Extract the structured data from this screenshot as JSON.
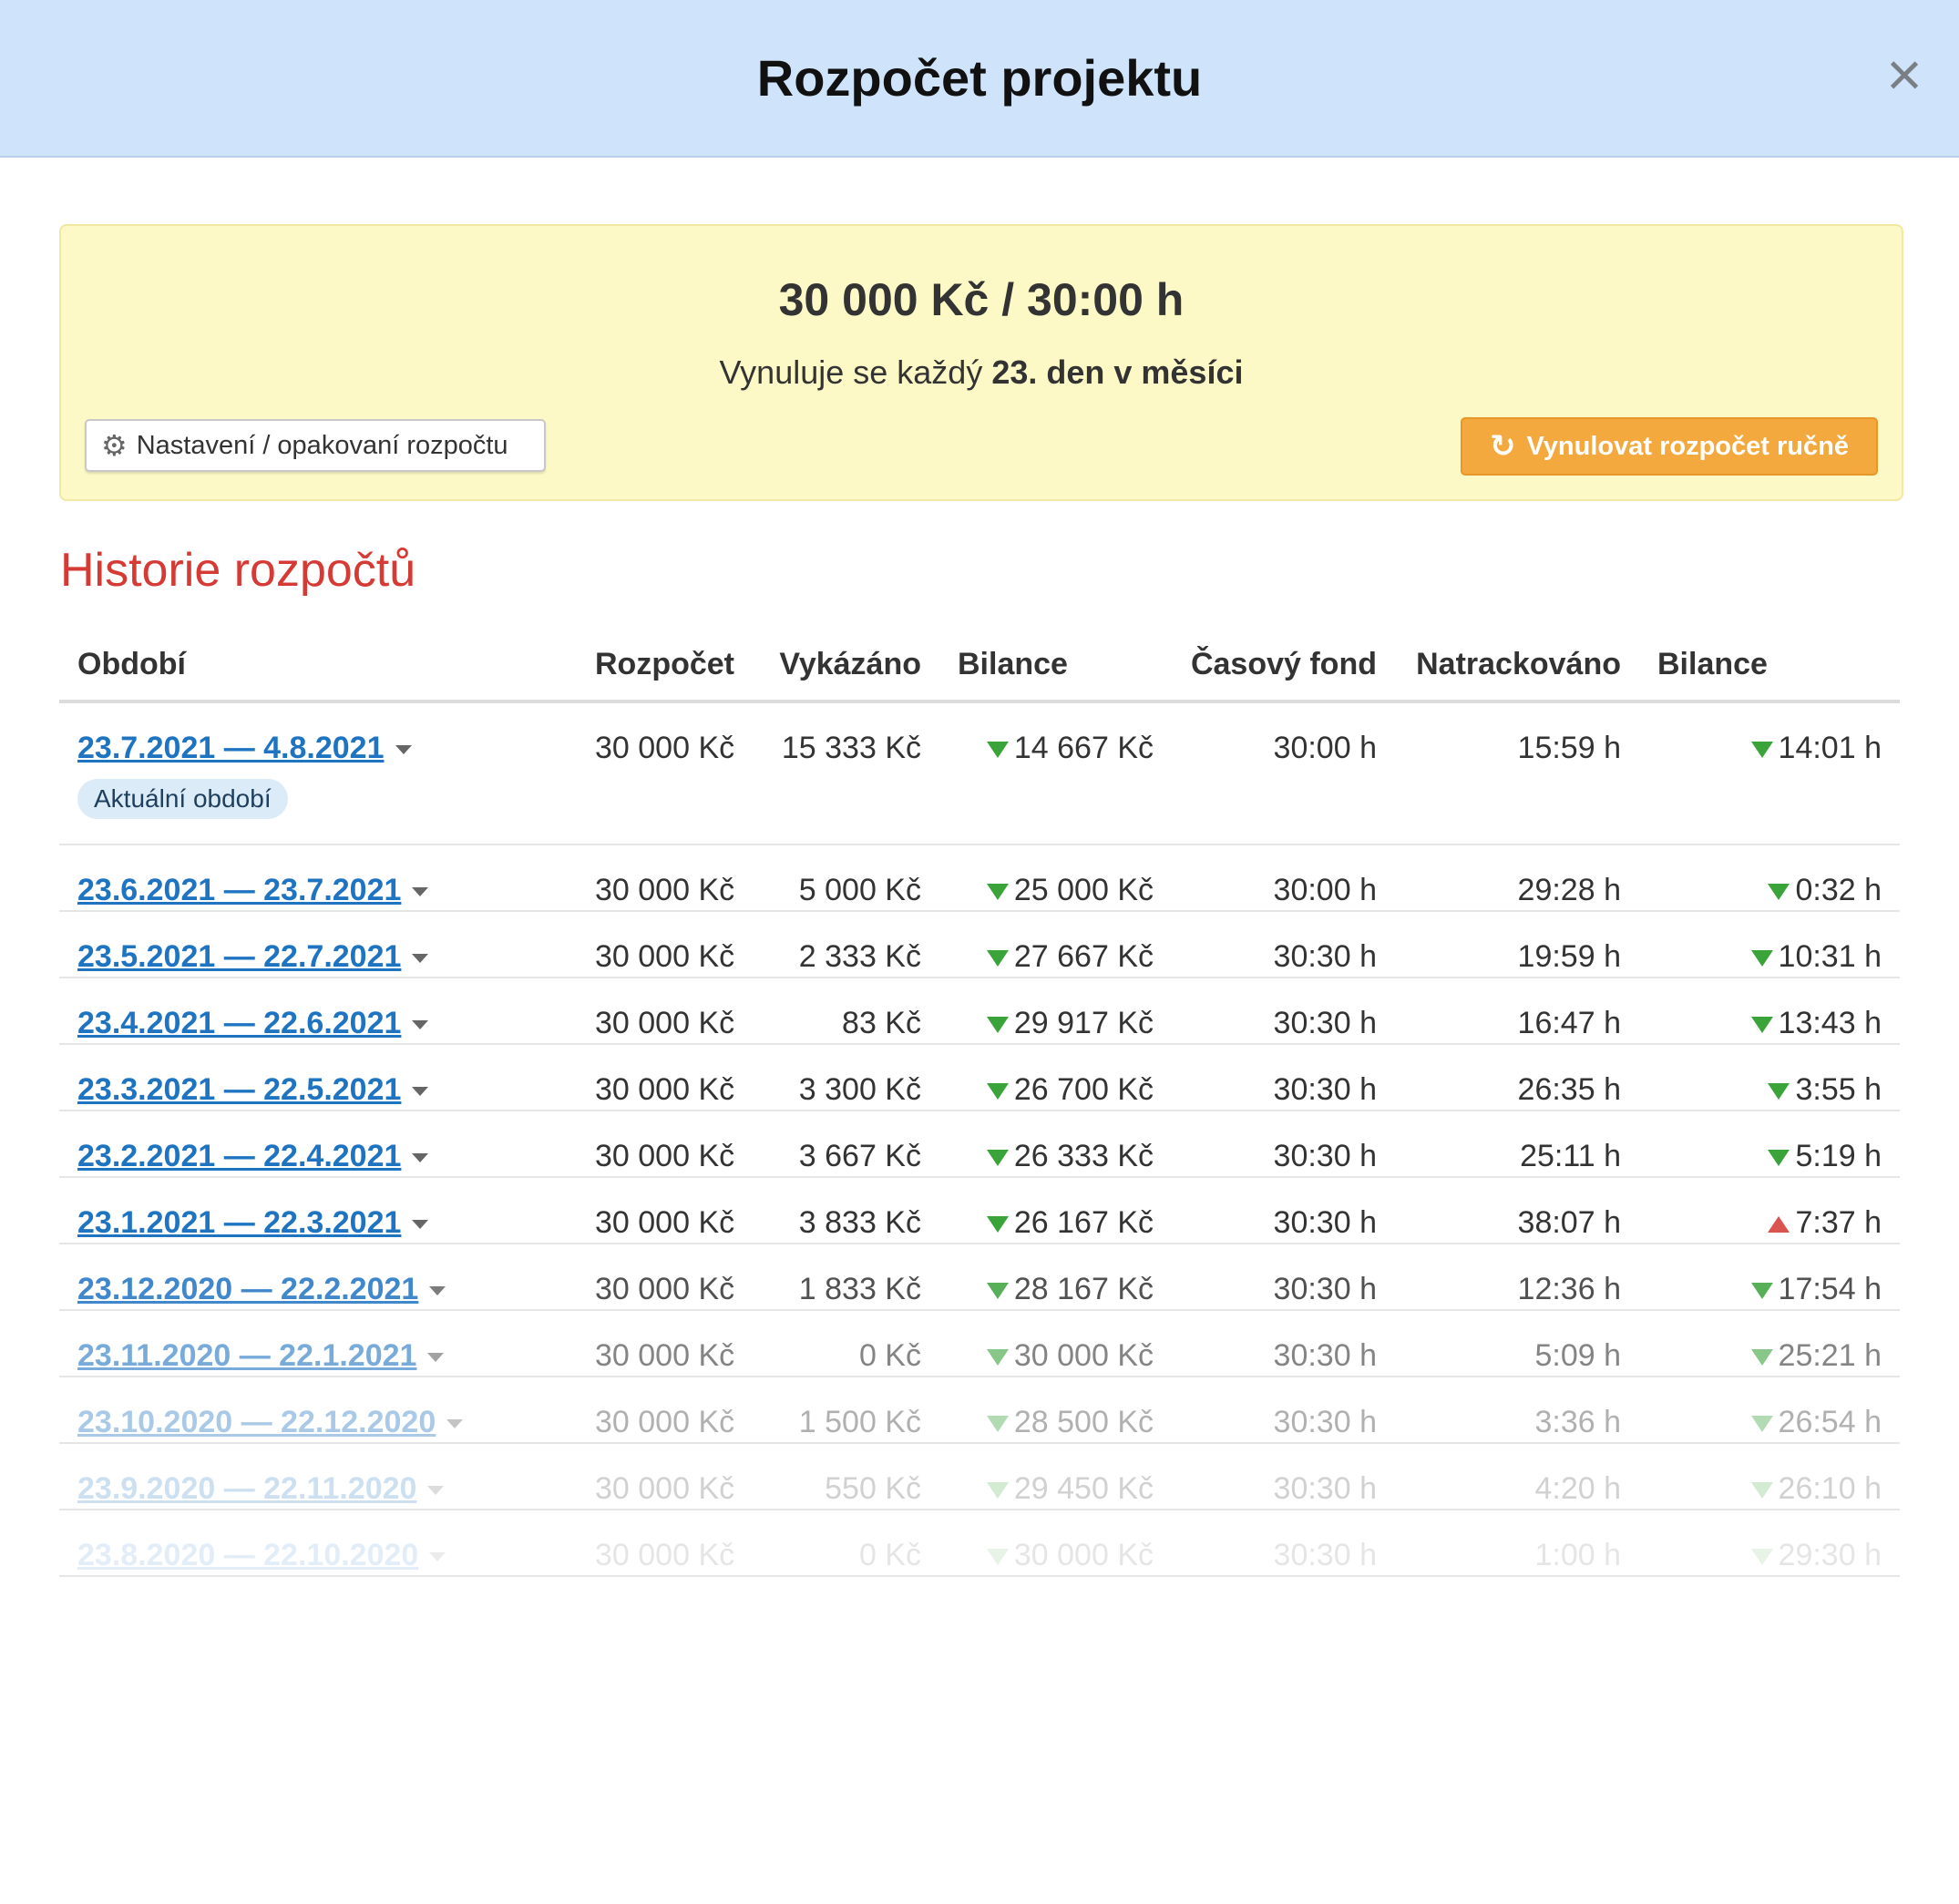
{
  "modal": {
    "title": "Rozpočet projektu",
    "close_label": "×"
  },
  "budget": {
    "amount": "30 000 Kč / 30:00 h",
    "reset_prefix": "Vynuluje se každý ",
    "reset_day": "23. den v měsíci",
    "settings_button": "Nastavení / opakovaní rozpočtu",
    "reset_button": "Vynulovat rozpočet ručně",
    "reset_button_color": "#f4a93f"
  },
  "history": {
    "title": "Historie rozpočtů",
    "columns": [
      "Období",
      "Rozpočet",
      "Vykázáno",
      "Bilance",
      "Časový fond",
      "Natrackováno",
      "Bilance"
    ],
    "current_badge": "Aktuální období",
    "rows": [
      {
        "period": "23.7.2021 — 4.8.2021",
        "budget": "30 000 Kč",
        "reported": "15 333 Kč",
        "balance": "14 667 Kč",
        "balance_dir": "down",
        "fund": "30:00 h",
        "tracked": "15:59 h",
        "time_balance": "14:01 h",
        "time_dir": "down",
        "current": true,
        "fade": 0
      },
      {
        "period": "23.6.2021 — 23.7.2021",
        "budget": "30 000 Kč",
        "reported": "5 000 Kč",
        "balance": "25 000 Kč",
        "balance_dir": "down",
        "fund": "30:00 h",
        "tracked": "29:28 h",
        "time_balance": "0:32 h",
        "time_dir": "down",
        "current": false,
        "fade": 0
      },
      {
        "period": "23.5.2021 — 22.7.2021",
        "budget": "30 000 Kč",
        "reported": "2 333 Kč",
        "balance": "27 667 Kč",
        "balance_dir": "down",
        "fund": "30:30 h",
        "tracked": "19:59 h",
        "time_balance": "10:31 h",
        "time_dir": "down",
        "current": false,
        "fade": 0
      },
      {
        "period": "23.4.2021 — 22.6.2021",
        "budget": "30 000 Kč",
        "reported": "83 Kč",
        "balance": "29 917 Kč",
        "balance_dir": "down",
        "fund": "30:30 h",
        "tracked": "16:47 h",
        "time_balance": "13:43 h",
        "time_dir": "down",
        "current": false,
        "fade": 0
      },
      {
        "period": "23.3.2021 — 22.5.2021",
        "budget": "30 000 Kč",
        "reported": "3 300 Kč",
        "balance": "26 700 Kč",
        "balance_dir": "down",
        "fund": "30:30 h",
        "tracked": "26:35 h",
        "time_balance": "3:55 h",
        "time_dir": "down",
        "current": false,
        "fade": 0
      },
      {
        "period": "23.2.2021 — 22.4.2021",
        "budget": "30 000 Kč",
        "reported": "3 667 Kč",
        "balance": "26 333 Kč",
        "balance_dir": "down",
        "fund": "30:30 h",
        "tracked": "25:11 h",
        "time_balance": "5:19 h",
        "time_dir": "down",
        "current": false,
        "fade": 0
      },
      {
        "period": "23.1.2021 — 22.3.2021",
        "budget": "30 000 Kč",
        "reported": "3 833 Kč",
        "balance": "26 167 Kč",
        "balance_dir": "down",
        "fund": "30:30 h",
        "tracked": "38:07 h",
        "time_balance": "7:37 h",
        "time_dir": "up",
        "current": false,
        "fade": 0
      },
      {
        "period": "23.12.2020 — 22.2.2021",
        "budget": "30 000 Kč",
        "reported": "1 833 Kč",
        "balance": "28 167 Kč",
        "balance_dir": "down",
        "fund": "30:30 h",
        "tracked": "12:36 h",
        "time_balance": "17:54 h",
        "time_dir": "down",
        "current": false,
        "fade": 1
      },
      {
        "period": "23.11.2020 — 22.1.2021",
        "budget": "30 000 Kč",
        "reported": "0 Kč",
        "balance": "30 000 Kč",
        "balance_dir": "down",
        "fund": "30:30 h",
        "tracked": "5:09 h",
        "time_balance": "25:21 h",
        "time_dir": "down",
        "current": false,
        "fade": 2
      },
      {
        "period": "23.10.2020 — 22.12.2020",
        "budget": "30 000 Kč",
        "reported": "1 500 Kč",
        "balance": "28 500 Kč",
        "balance_dir": "down",
        "fund": "30:30 h",
        "tracked": "3:36 h",
        "time_balance": "26:54 h",
        "time_dir": "down",
        "current": false,
        "fade": 3
      },
      {
        "period": "23.9.2020 — 22.11.2020",
        "budget": "30 000 Kč",
        "reported": "550 Kč",
        "balance": "29 450 Kč",
        "balance_dir": "down",
        "fund": "30:30 h",
        "tracked": "4:20 h",
        "time_balance": "26:10 h",
        "time_dir": "down",
        "current": false,
        "fade": 4
      },
      {
        "period": "23.8.2020 — 22.10.2020",
        "budget": "30 000 Kč",
        "reported": "0 Kč",
        "balance": "30 000 Kč",
        "balance_dir": "down",
        "fund": "30:30 h",
        "tracked": "1:00 h",
        "time_balance": "29:30 h",
        "time_dir": "down",
        "current": false,
        "fade": 5
      }
    ]
  }
}
